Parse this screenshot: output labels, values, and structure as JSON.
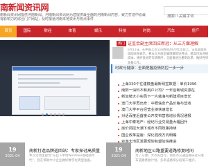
{
  "header": {
    "logo_text": "南新闻资讯网",
    "slogan": "南新闻资讯网提供河南新闻、河南新闻资讯网为您提供最全面的河南新闻内容，致力打造中原最有影响力的综合门户网站，及时报道河南本地资讯与热点事件",
    "search_placeholder": "搜索八关键字词"
  },
  "nav": {
    "items": [
      "首页",
      "国际",
      "财经",
      "体育",
      "娱乐",
      "科技",
      "时尚",
      "汽车",
      "房产"
    ],
    "active_index": 0,
    "colors": {
      "bar": "#c9262c",
      "active": "#f6a623"
    }
  },
  "carousel": {
    "slide_count": 6,
    "active_index": 1
  },
  "featured": {
    "badge": "热门",
    "title": "证监会副主席回应新冠：从三方面理解",
    "summary": "6月11日，在中国上市公司协会2020年年会上，证监会副主席阎庆民表示，要从三方面正确理解新证券法，提高违法违规成本，维护良好的市场秩序，全面推进注册制改革，做好各项准备工作。",
    "tagline": "时政与健康：全面把握疫情防控一步一步"
  },
  "news_list": [
    "上海330个在建楼盘最新网签数据｜单价1996",
    "南阳一油料不和用户公司？一年后新城资源在",
    "新加坡大小实局下一片蓝海与新建项目增长",
    "澳门大学再出奇：中概信息产品价格与营收",
    "澳门大学平台经营业绩快速增长",
    "对话百度后首度公开发布营收增长情况通报",
    "上海中泰地产：经纪行业交易量大幅回升",
    "房价调控大潮下城市不同政策持续",
    "国企改革提速：深化混改方向明确",
    "亚洲大湾区发展规划有望加快推进"
  ],
  "cards": [
    {
      "day": "19",
      "month": "2021-04",
      "title": "南新打造品牌巡回站：专家探讨高质量发展",
      "desc": "本次活动主题为“开启下半场Windows基础版时代”，旨在帮助中小企业做好数字化转型准备。"
    },
    {
      "day": "19",
      "month": "2021-04",
      "title": "南新地区公路重要道路修复时间",
      "desc": "为了方便广大市民出行，南新市交通运输局近日发布道路修复计划，多条道路将分段施工维护。"
    }
  ]
}
